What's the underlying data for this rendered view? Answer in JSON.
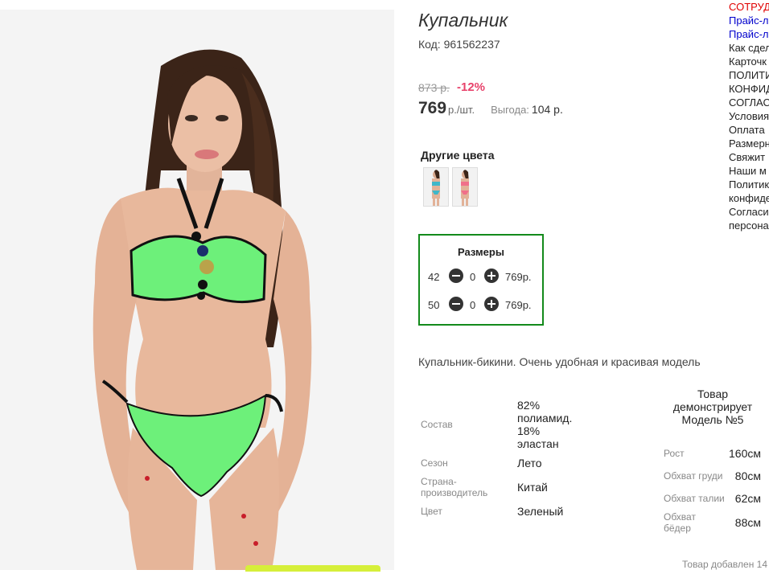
{
  "product": {
    "title": "Купальник",
    "code_label": "Код:",
    "code": "961562237",
    "old_price": "873 р.",
    "discount": "-12%",
    "price": "769",
    "price_unit": "р./шт.",
    "benefit_label": "Выгода:",
    "benefit_value": "104 р."
  },
  "other_colors": {
    "title": "Другие цвета",
    "thumbs": [
      "blue-swimsuit-thumbnail",
      "pink-swimsuit-thumbnail"
    ]
  },
  "sizes": {
    "title": "Размеры",
    "rows": [
      {
        "size": "42",
        "qty": "0",
        "price": "769р."
      },
      {
        "size": "50",
        "qty": "0",
        "price": "769р."
      }
    ]
  },
  "description": "Купальник-бикини. Очень удобная и красивая модель",
  "specs": {
    "composition_label": "Состав",
    "composition_value": "82% полиамид. 18% эластан",
    "season_label": "Сезон",
    "season_value": "Лето",
    "country_label": "Страна-производитель",
    "country_value": "Китай",
    "color_label": "Цвет",
    "color_value": "Зеленый"
  },
  "model": {
    "title": "Товар демонстрирует Модель №5",
    "height_label": "Рост",
    "height_value": "160см",
    "chest_label": "Обхват груди",
    "chest_value": "80см",
    "waist_label": "Обхват талии",
    "waist_value": "62см",
    "hips_label": "Обхват бёдер",
    "hips_value": "88см"
  },
  "added_text": "Товар добавлен 14",
  "right_nav": [
    {
      "label": "СОТРУД",
      "color": "red"
    },
    {
      "label": "Прайс-л",
      "color": "blue"
    },
    {
      "label": "Прайс-л",
      "color": "blue"
    },
    {
      "label": "Как сдел",
      "color": "black"
    },
    {
      "label": "Карточк",
      "color": "black"
    },
    {
      "label": "ПОЛИТИ",
      "color": "black"
    },
    {
      "label": "КОНФИД",
      "color": "black"
    },
    {
      "label": "СОГЛАС",
      "color": "black"
    },
    {
      "label": "Условия",
      "color": "black"
    },
    {
      "label": "Оплата",
      "color": "black"
    },
    {
      "label": "Размерн",
      "color": "black"
    },
    {
      "label": "Свяжит",
      "color": "black"
    },
    {
      "label": "Наши м",
      "color": "black"
    },
    {
      "label": "Политик",
      "color": "black"
    },
    {
      "label": "конфиде",
      "color": "black"
    },
    {
      "label": "Согласи",
      "color": "black"
    },
    {
      "label": "персона",
      "color": "black"
    }
  ],
  "colors": {
    "accent_red": "#e8426b",
    "sizes_border": "#138a1b",
    "nav_red": "#e00000",
    "nav_blue": "#0000cc",
    "swimsuit_green": "#6df07a"
  }
}
